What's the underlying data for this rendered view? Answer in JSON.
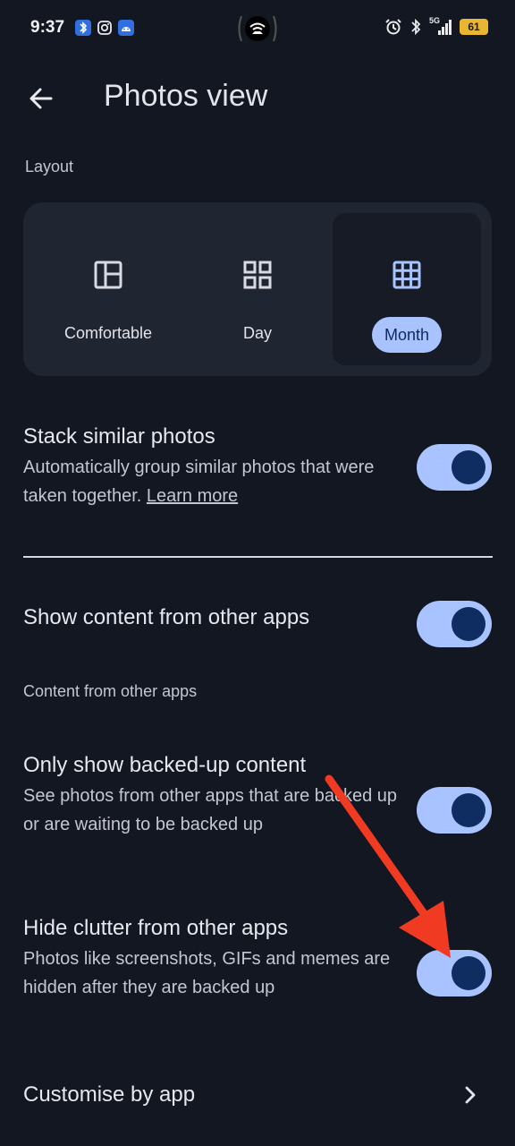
{
  "status_bar": {
    "time": "9:37",
    "network": "5G",
    "battery": "61",
    "notification_icons": [
      "bluetooth-app-icon",
      "instagram-icon",
      "android-app-icon"
    ]
  },
  "header": {
    "title": "Photos view"
  },
  "layout_section": {
    "label": "Layout",
    "options": [
      {
        "label": "Comfortable",
        "icon": "comfortable-layout-icon",
        "selected": false
      },
      {
        "label": "Day",
        "icon": "day-grid-icon",
        "selected": false
      },
      {
        "label": "Month",
        "icon": "month-grid-icon",
        "selected": true
      }
    ]
  },
  "stack_similar": {
    "title": "Stack similar photos",
    "description": "Automatically group similar photos that were taken together.",
    "link": "Learn more",
    "enabled": true
  },
  "show_other_apps": {
    "title": "Show content from other apps",
    "enabled": true
  },
  "other_apps_section": {
    "label": "Content from other apps"
  },
  "backed_up_only": {
    "title": "Only show backed-up content",
    "description": "See photos from other apps that are backed up or are waiting to be backed up",
    "enabled": true
  },
  "hide_clutter": {
    "title": "Hide clutter from other apps",
    "description": "Photos like screenshots, GIFs and memes are hidden after they are backed up",
    "enabled": true
  },
  "customise": {
    "title": "Customise by app"
  },
  "colors": {
    "background": "#131722",
    "toggle_track": "#a8c3ff",
    "toggle_knob": "#0f2d60",
    "annotation_arrow": "#f13a22"
  }
}
